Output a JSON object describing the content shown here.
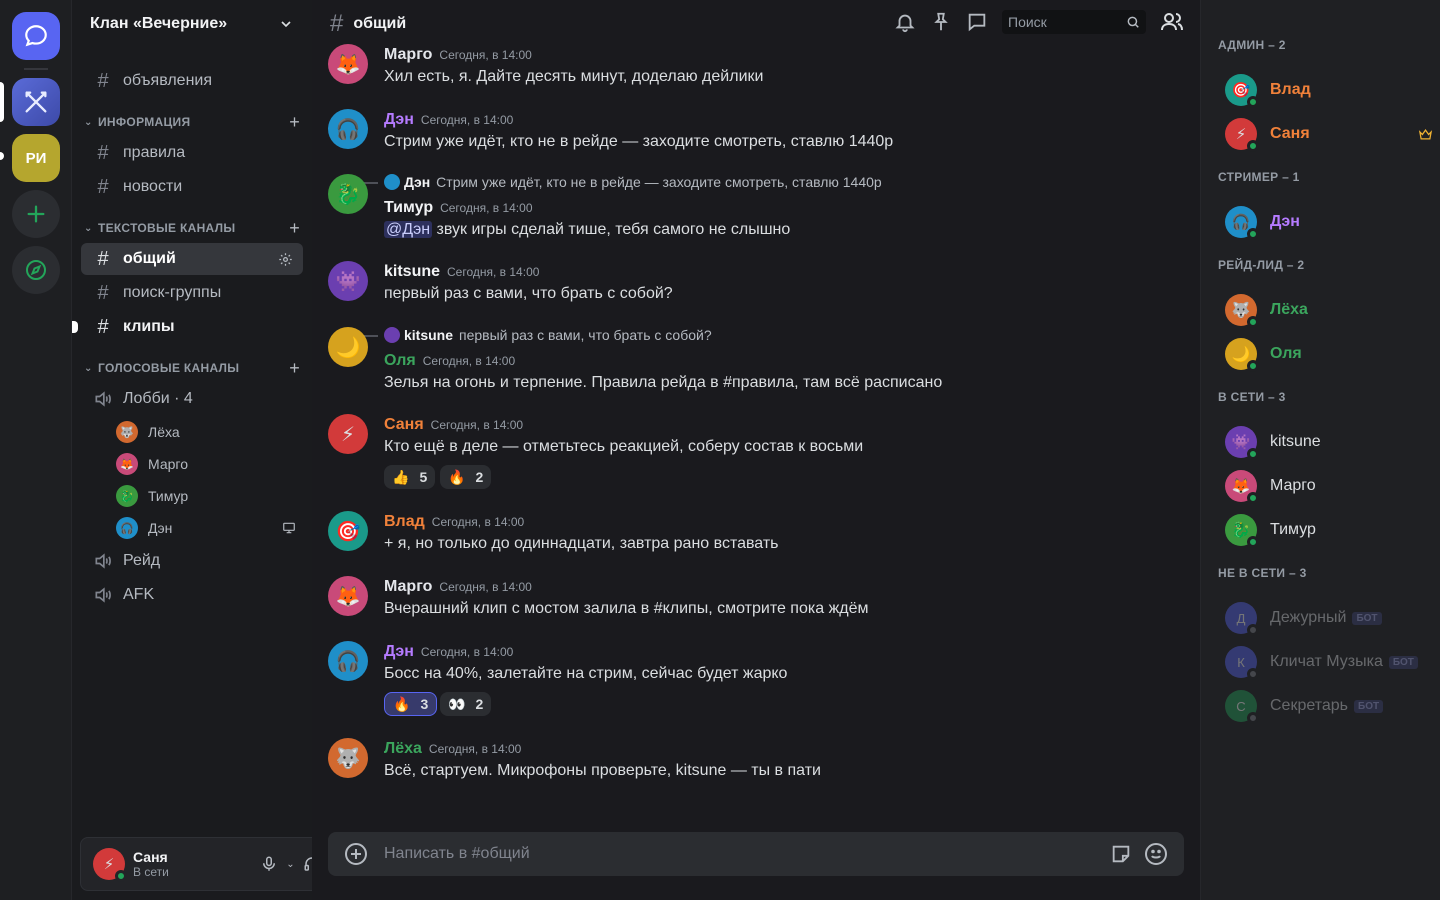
{
  "guild": {
    "name": "Клан «Вечерние»",
    "abbr": "РИ"
  },
  "channels": {
    "top": "объявления",
    "cat_info": "ИНФОРМАЦИЯ",
    "info": [
      "правила",
      "новости"
    ],
    "cat_text": "ТЕКСТОВЫЕ КАНАЛЫ",
    "text": [
      "общий",
      "поиск-группы",
      "клипы"
    ],
    "cat_voice": "ГОЛОСОВЫЕ КАНАЛЫ",
    "voice": [
      {
        "name": "Лобби · 4",
        "users": [
          "Лёха",
          "Марго",
          "Тимур",
          "Дэн"
        ]
      },
      {
        "name": "Рейд"
      },
      {
        "name": "AFK"
      }
    ]
  },
  "user": {
    "name": "Саня",
    "status": "В сети"
  },
  "header": {
    "channel": "общий",
    "search_placeholder": "Поиск"
  },
  "messages": [
    {
      "author": "Марго",
      "time": "Сегодня, в 14:00",
      "text": "Хил есть, я. Дайте десять минут, доделаю дейлики"
    },
    {
      "author": "Дэн",
      "time": "Сегодня, в 14:00",
      "text": "Стрим уже идёт, кто не в рейде — заходите смотреть, ставлю 1440p"
    },
    {
      "author": "Тимур",
      "time": "Сегодня, в 14:00",
      "reply_to": "Дэн",
      "reply_text": "Стрим уже идёт, кто не в рейде — заходите смотреть, ставлю 1440p",
      "mention": "@Дэн",
      "text": " звук игры сделай тише, тебя самого не слышно"
    },
    {
      "author": "kitsune",
      "time": "Сегодня, в 14:00",
      "text": "первый раз с вами, что брать с собой?"
    },
    {
      "author": "Оля",
      "time": "Сегодня, в 14:00",
      "reply_to": "kitsune",
      "reply_text": "первый раз с вами, что брать с собой?",
      "text": "Зелья на огонь и терпение. Правила рейда в #правила, там всё расписано"
    },
    {
      "author": "Саня",
      "time": "Сегодня, в 14:00",
      "text": "Кто ещё в деле — отметьтесь реакцией, соберу состав к восьми",
      "reactions": [
        {
          "emoji": "👍",
          "count": "5"
        },
        {
          "emoji": "🔥",
          "count": "2"
        }
      ]
    },
    {
      "author": "Влад",
      "time": "Сегодня, в 14:00",
      "text": "+ я, но только до одиннадцати, завтра рано вставать"
    },
    {
      "author": "Марго",
      "time": "Сегодня, в 14:00",
      "text": "Вчерашний клип с мостом залила в #клипы, смотрите пока ждём"
    },
    {
      "author": "Дэн",
      "time": "Сегодня, в 14:00",
      "text": "Босс на 40%, залетайте на стрим, сейчас будет жарко",
      "reactions": [
        {
          "emoji": "🔥",
          "count": "3"
        },
        {
          "emoji": "👀",
          "count": "2"
        }
      ]
    },
    {
      "author": "Лёха",
      "time": "Сегодня, в 14:00",
      "text": "Всё, стартуем. Микрофоны проверьте, kitsune — ты в пати"
    }
  ],
  "composer": {
    "placeholder": "Написать в #общий"
  },
  "members": {
    "groups": [
      {
        "title": "АДМИН – 2",
        "items": [
          "Влад",
          "Саня"
        ]
      },
      {
        "title": "СТРИМЕР – 1",
        "items": [
          "Дэн"
        ]
      },
      {
        "title": "РЕЙД-ЛИД – 2",
        "items": [
          "Лёха",
          "Оля"
        ]
      },
      {
        "title": "В СЕТИ – 3",
        "items": [
          "kitsune",
          "Марго",
          "Тимур"
        ]
      },
      {
        "title": "НЕ В СЕТИ – 3",
        "items": [
          "Дежурный",
          "Кличат Музыка",
          "Секретарь"
        ]
      }
    ],
    "bot_label": "БОТ",
    "offline_initials": [
      "Д",
      "К",
      "С"
    ]
  },
  "colors": {
    "Марго": "#e4e6eb",
    "Дэн": "#b57bff",
    "Тимур": "#f2f3f5",
    "kitsune": "#f2f3f5",
    "Оля": "#3ba55d",
    "Саня": "#f0813a",
    "Влад": "#f0813a",
    "Лёха": "#3ba55d"
  },
  "icons": [
    "chat-bubble-icon",
    "crossed-swords-icon",
    "plus-icon",
    "compass-icon",
    "bell-icon",
    "pin-icon",
    "threads-icon",
    "search-icon",
    "members-icon",
    "gear-icon",
    "speaker-icon",
    "screen-share-icon",
    "microphone-icon",
    "headphones-icon",
    "add-circle-icon",
    "gif-icon",
    "emoji-icon",
    "crown-icon"
  ]
}
